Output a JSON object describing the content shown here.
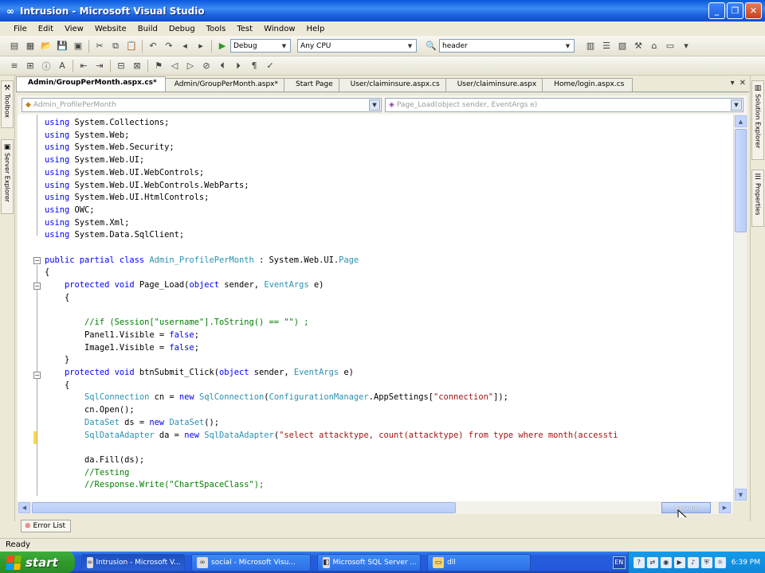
{
  "window": {
    "title": "Intrusion - Microsoft Visual Studio",
    "minimize": "_",
    "restore": "❐",
    "close": "✕"
  },
  "menu": [
    "File",
    "Edit",
    "View",
    "Website",
    "Build",
    "Debug",
    "Tools",
    "Test",
    "Window",
    "Help"
  ],
  "toolbar": {
    "config_combo": "Debug",
    "platform_combo": "Any CPU",
    "find_combo": "header"
  },
  "doc_tabs": [
    "Admin/GroupPerMonth.aspx.cs*",
    "Admin/GroupPerMonth.aspx*",
    "Start Page",
    "User/claiminsure.aspx.cs",
    "User/claiminsure.aspx",
    "Home/login.aspx.cs"
  ],
  "tab_controls": {
    "close": "✕",
    "pin": "▾"
  },
  "nav": {
    "class_combo": "Admin_ProfilePerMonth",
    "member_combo": "Page_Load(object sender, EventArgs e)"
  },
  "side_tabs": {
    "left": [
      "Toolbox",
      "Server Explorer"
    ],
    "right": [
      "Solution Explorer",
      "Properties"
    ]
  },
  "code_lines": [
    [
      {
        "t": "using",
        "c": "kw"
      },
      {
        "t": " System.Collections;"
      }
    ],
    [
      {
        "t": "using",
        "c": "kw"
      },
      {
        "t": " System.Web;"
      }
    ],
    [
      {
        "t": "using",
        "c": "kw"
      },
      {
        "t": " System.Web.Security;"
      }
    ],
    [
      {
        "t": "using",
        "c": "kw"
      },
      {
        "t": " System.Web.UI;"
      }
    ],
    [
      {
        "t": "using",
        "c": "kw"
      },
      {
        "t": " System.Web.UI.WebControls;"
      }
    ],
    [
      {
        "t": "using",
        "c": "kw"
      },
      {
        "t": " System.Web.UI.WebControls.WebParts;"
      }
    ],
    [
      {
        "t": "using",
        "c": "kw"
      },
      {
        "t": " System.Web.UI.HtmlControls;"
      }
    ],
    [
      {
        "t": "using",
        "c": "kw"
      },
      {
        "t": " OWC;"
      }
    ],
    [
      {
        "t": "using",
        "c": "kw"
      },
      {
        "t": " System.Xml;"
      }
    ],
    [
      {
        "t": "using",
        "c": "kw"
      },
      {
        "t": " System.Data.SqlClient;"
      }
    ],
    [],
    [
      {
        "t": "public partial class",
        "c": "kw"
      },
      {
        "t": " "
      },
      {
        "t": "Admin_ProfilePerMonth",
        "c": "ty"
      },
      {
        "t": " : System.Web.UI."
      },
      {
        "t": "Page",
        "c": "ty"
      }
    ],
    [
      {
        "t": "{"
      }
    ],
    [
      {
        "t": "    "
      },
      {
        "t": "protected void",
        "c": "kw"
      },
      {
        "t": " Page_Load("
      },
      {
        "t": "object",
        "c": "kw"
      },
      {
        "t": " sender, "
      },
      {
        "t": "EventArgs",
        "c": "ty"
      },
      {
        "t": " e)"
      }
    ],
    [
      {
        "t": "    {"
      }
    ],
    [],
    [
      {
        "t": "        "
      },
      {
        "t": "//if (Session[\"username\"].ToString() == \"\") ;",
        "c": "cm"
      }
    ],
    [
      {
        "t": "        Panel1.Visible = "
      },
      {
        "t": "false",
        "c": "kw"
      },
      {
        "t": ";"
      }
    ],
    [
      {
        "t": "        Image1.Visible = "
      },
      {
        "t": "false",
        "c": "kw"
      },
      {
        "t": ";"
      }
    ],
    [
      {
        "t": "    }"
      }
    ],
    [
      {
        "t": "    "
      },
      {
        "t": "protected void",
        "c": "kw"
      },
      {
        "t": " btnSubmit_Click("
      },
      {
        "t": "object",
        "c": "kw"
      },
      {
        "t": " sender, "
      },
      {
        "t": "EventArgs",
        "c": "ty"
      },
      {
        "t": " e)"
      }
    ],
    [
      {
        "t": "    {"
      }
    ],
    [
      {
        "t": "        "
      },
      {
        "t": "SqlConnection",
        "c": "ty"
      },
      {
        "t": " cn = "
      },
      {
        "t": "new",
        "c": "kw"
      },
      {
        "t": " "
      },
      {
        "t": "SqlConnection",
        "c": "ty"
      },
      {
        "t": "("
      },
      {
        "t": "ConfigurationManager",
        "c": "ty"
      },
      {
        "t": ".AppSettings["
      },
      {
        "t": "\"connection\"",
        "c": "st"
      },
      {
        "t": "]);"
      }
    ],
    [
      {
        "t": "        cn.Open();"
      }
    ],
    [
      {
        "t": "        "
      },
      {
        "t": "DataSet",
        "c": "ty"
      },
      {
        "t": " ds = "
      },
      {
        "t": "new",
        "c": "kw"
      },
      {
        "t": " "
      },
      {
        "t": "DataSet",
        "c": "ty"
      },
      {
        "t": "();"
      }
    ],
    [
      {
        "t": "        "
      },
      {
        "t": "SqlDataAdapter",
        "c": "ty"
      },
      {
        "t": " da = "
      },
      {
        "t": "new",
        "c": "kw"
      },
      {
        "t": " "
      },
      {
        "t": "SqlDataAdapter",
        "c": "ty"
      },
      {
        "t": "("
      },
      {
        "t": "\"select attacktype, count(attacktype) from type where month(accessti",
        "c": "st"
      }
    ],
    [],
    [
      {
        "t": "        da.Fill(ds);"
      }
    ],
    [
      {
        "t": "        "
      },
      {
        "t": "//Testing",
        "c": "cm"
      }
    ],
    [
      {
        "t": "        "
      },
      {
        "t": "//Response.Write(\"ChartSpaceClass\");",
        "c": "cm"
      }
    ]
  ],
  "record_button": "Record",
  "error_list_tab": "Error List",
  "status": "Ready",
  "taskbar": {
    "start": "start",
    "tasks": [
      "Intrusion - Microsoft V...",
      "social - Microsoft Visu...",
      "Microsoft SQL Server ...",
      "dll"
    ],
    "clock": "6:39 PM",
    "lang": "EN"
  }
}
